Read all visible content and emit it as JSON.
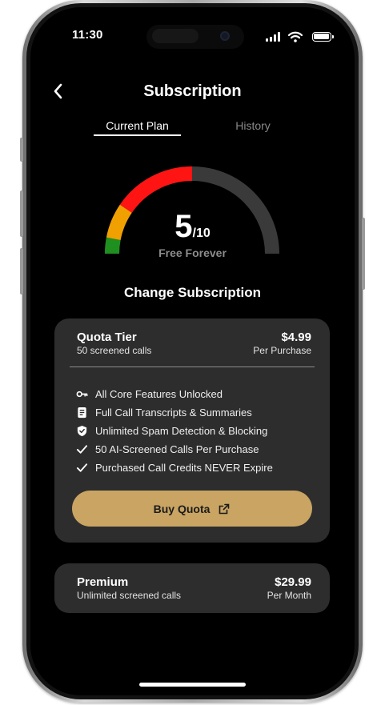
{
  "status_bar": {
    "time": "11:30"
  },
  "header": {
    "title": "Subscription"
  },
  "tabs": [
    {
      "label": "Current Plan",
      "active": true
    },
    {
      "label": "History",
      "active": false
    }
  ],
  "current_plan": {
    "score": "5",
    "score_max": "/10",
    "score_fraction": 0.5,
    "plan_name": "Free Forever",
    "gauge_colors": [
      "#1f8f1f",
      "#f0a000",
      "#ff1414",
      "#3a3a3a"
    ]
  },
  "section_title": "Change Subscription",
  "plans": [
    {
      "name": "Quota Tier",
      "subtitle": "50 screened calls",
      "price": "$4.99",
      "period": "Per Purchase",
      "features": [
        {
          "icon": "key-icon",
          "text": "All Core Features Unlocked"
        },
        {
          "icon": "document-icon",
          "text": "Full Call Transcripts & Summaries"
        },
        {
          "icon": "shield-icon",
          "text": "Unlimited Spam Detection & Blocking"
        },
        {
          "icon": "checkmark-icon",
          "text": "50 AI-Screened Calls Per Purchase"
        },
        {
          "icon": "checkmark-icon",
          "text": "Purchased Call Credits NEVER Expire"
        }
      ],
      "button_label": "Buy Quota",
      "button_icon": "external-link-icon"
    },
    {
      "name": "Premium",
      "subtitle": "Unlimited screened calls",
      "price": "$29.99",
      "period": "Per Month"
    }
  ],
  "colors": {
    "accent": "#c9a463",
    "card": "#2d2d2d",
    "background": "#000000",
    "muted_text": "#8a8a8a"
  }
}
